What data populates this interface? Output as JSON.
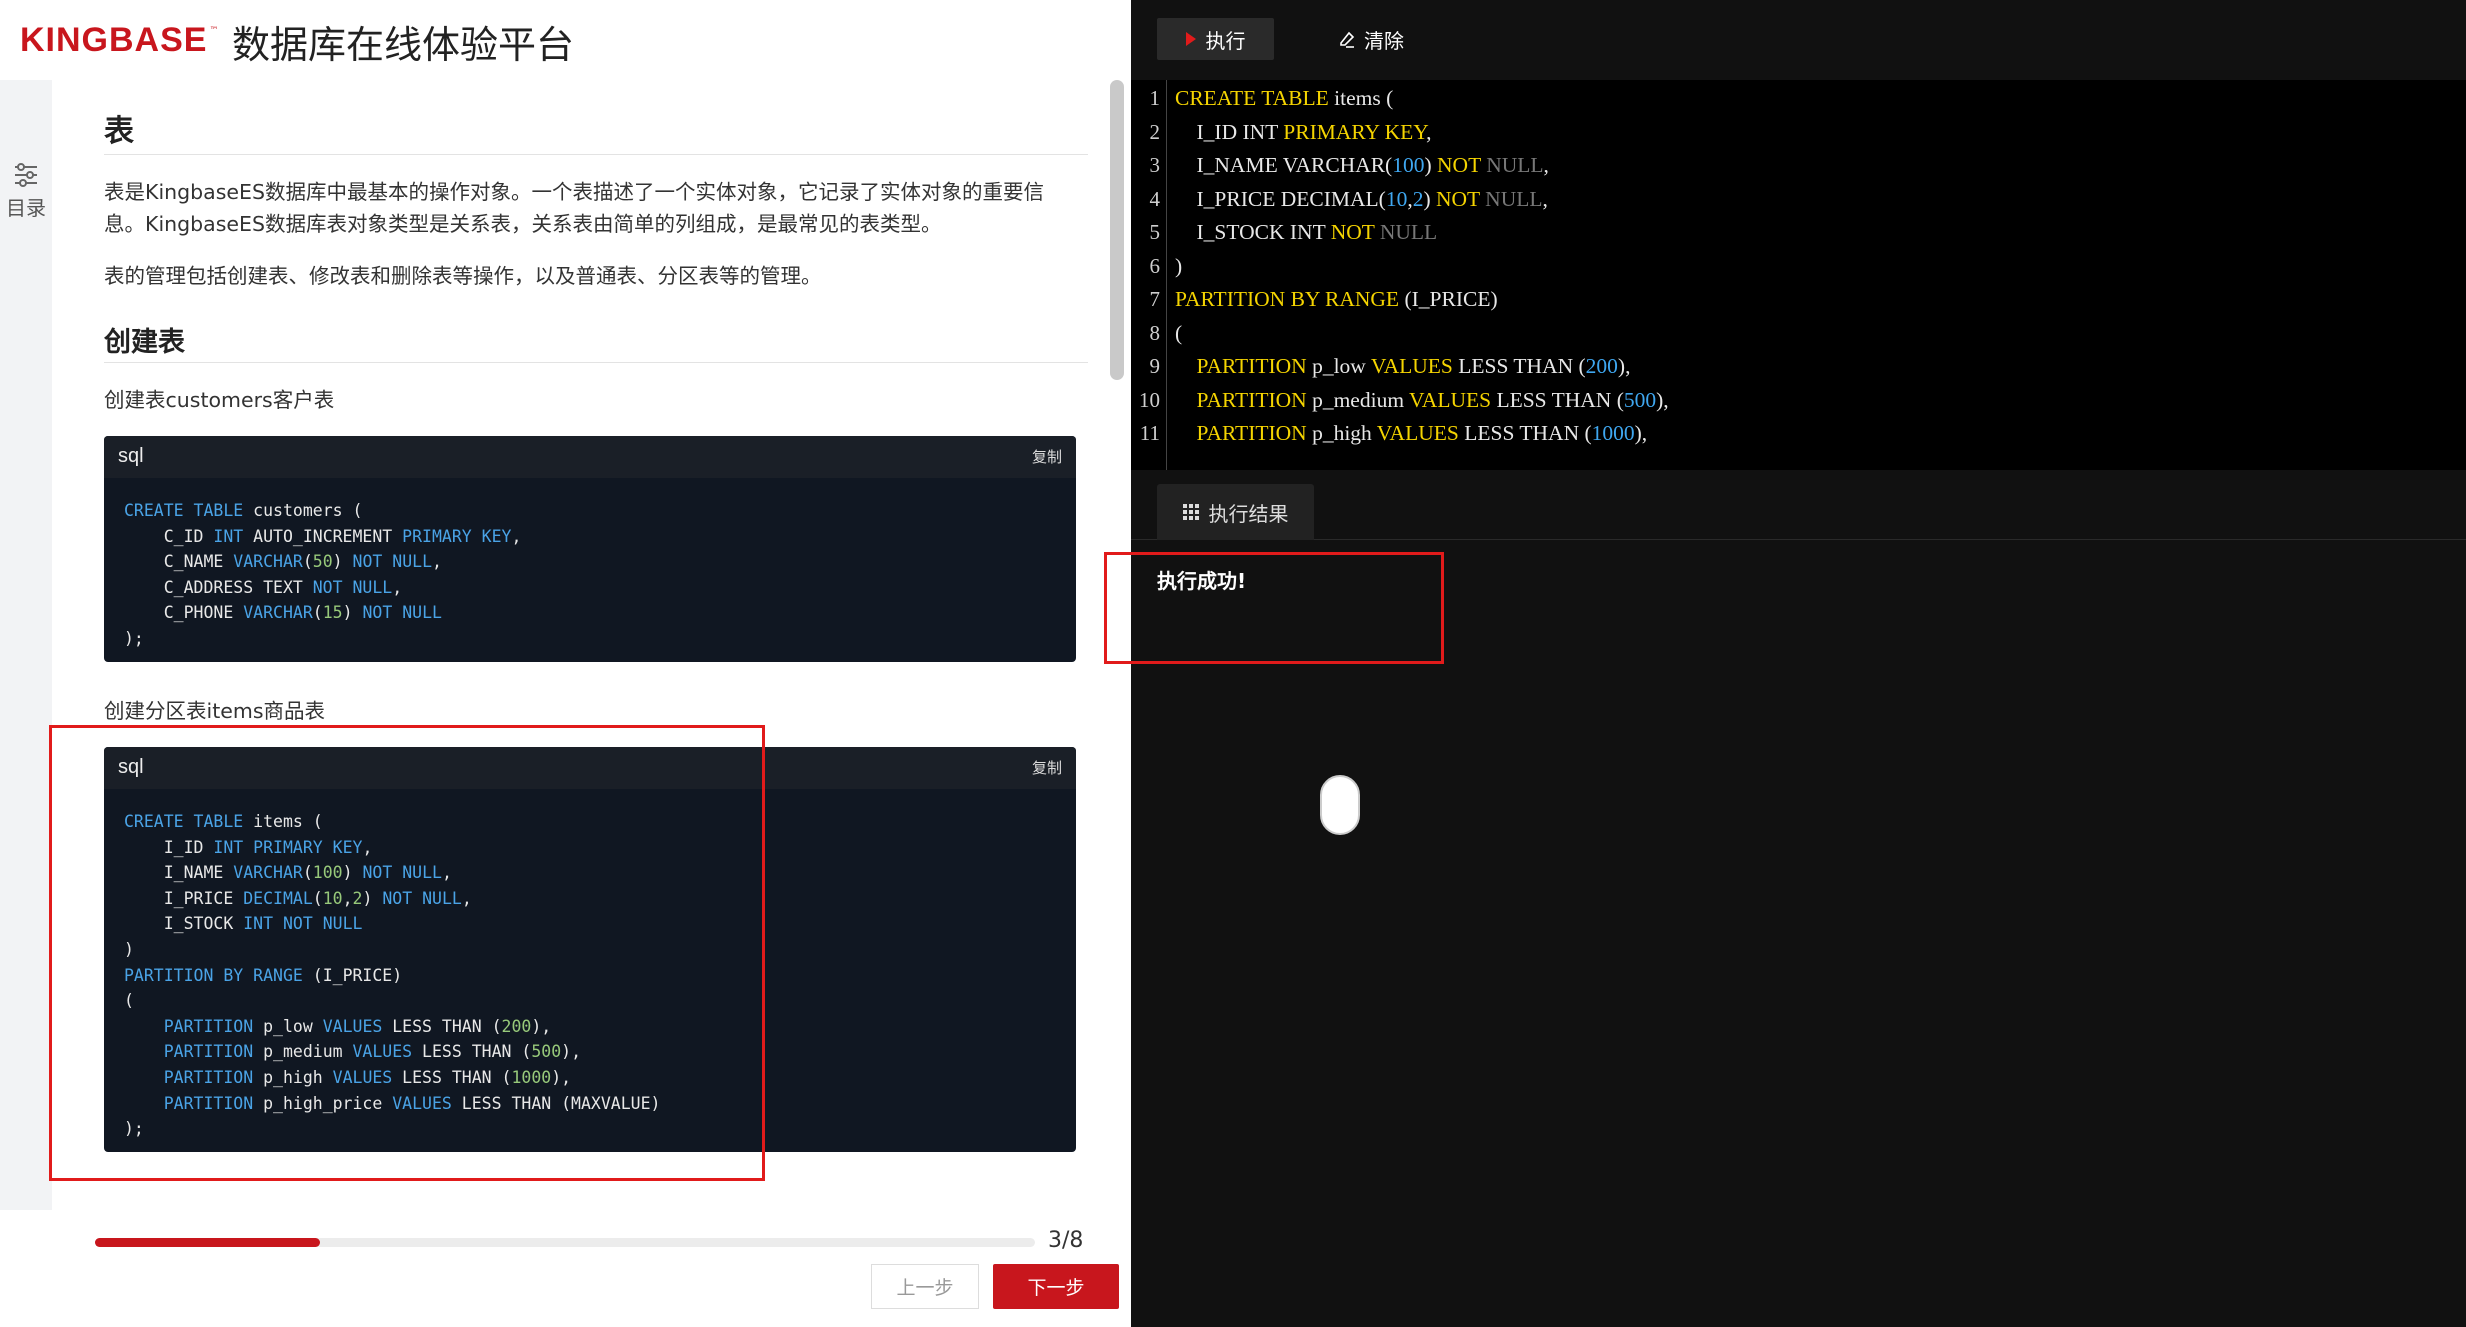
{
  "brand": {
    "logo": "KINGBASE",
    "logo_tm": "™",
    "title": "数据库在线体验平台"
  },
  "toc": {
    "label": "目录"
  },
  "doc": {
    "h1_table": "表",
    "p1": "表是KingbaseES数据库中最基本的操作对象。一个表描述了一个实体对象，它记录了实体对象的重要信息。KingbaseES数据库表对象类型是关系表，关系表由简单的列组成，是最常见的表类型。",
    "p2": "表的管理包括创建表、修改表和删除表等操作，以及普通表、分区表等的管理。",
    "h2_create": "创建表",
    "caption1": "创建表customers客户表",
    "caption2": "创建分区表items商品表",
    "code1_lang": "sql",
    "code2_lang": "sql",
    "copy_label": "复制",
    "code1": [
      [
        [
          "k",
          "CREATE"
        ],
        [
          "t",
          " "
        ],
        [
          "k",
          "TABLE"
        ],
        [
          "t",
          " customers ("
        ]
      ],
      [
        [
          "t",
          "    C_ID "
        ],
        [
          "k",
          "INT"
        ],
        [
          "t",
          " AUTO_INCREMENT "
        ],
        [
          "k",
          "PRIMARY"
        ],
        [
          "t",
          " "
        ],
        [
          "k",
          "KEY"
        ],
        [
          "t",
          ","
        ]
      ],
      [
        [
          "t",
          "    C_NAME "
        ],
        [
          "k",
          "VARCHAR"
        ],
        [
          "t",
          "("
        ],
        [
          "n",
          "50"
        ],
        [
          "t",
          ") "
        ],
        [
          "k",
          "NOT"
        ],
        [
          "t",
          " "
        ],
        [
          "k",
          "NULL"
        ],
        [
          "t",
          ","
        ]
      ],
      [
        [
          "t",
          "    C_ADDRESS TEXT "
        ],
        [
          "k",
          "NOT"
        ],
        [
          "t",
          " "
        ],
        [
          "k",
          "NULL"
        ],
        [
          "t",
          ","
        ]
      ],
      [
        [
          "t",
          "    C_PHONE "
        ],
        [
          "k",
          "VARCHAR"
        ],
        [
          "t",
          "("
        ],
        [
          "n",
          "15"
        ],
        [
          "t",
          ") "
        ],
        [
          "k",
          "NOT"
        ],
        [
          "t",
          " "
        ],
        [
          "k",
          "NULL"
        ]
      ],
      [
        [
          "t",
          ");"
        ]
      ]
    ],
    "code2": [
      [
        [
          "k",
          "CREATE"
        ],
        [
          "t",
          " "
        ],
        [
          "k",
          "TABLE"
        ],
        [
          "t",
          " items ("
        ]
      ],
      [
        [
          "t",
          "    I_ID "
        ],
        [
          "k",
          "INT"
        ],
        [
          "t",
          " "
        ],
        [
          "k",
          "PRIMARY"
        ],
        [
          "t",
          " "
        ],
        [
          "k",
          "KEY"
        ],
        [
          "t",
          ","
        ]
      ],
      [
        [
          "t",
          "    I_NAME "
        ],
        [
          "k",
          "VARCHAR"
        ],
        [
          "t",
          "("
        ],
        [
          "n",
          "100"
        ],
        [
          "t",
          ") "
        ],
        [
          "k",
          "NOT"
        ],
        [
          "t",
          " "
        ],
        [
          "k",
          "NULL"
        ],
        [
          "t",
          ","
        ]
      ],
      [
        [
          "t",
          "    I_PRICE "
        ],
        [
          "k",
          "DECIMAL"
        ],
        [
          "t",
          "("
        ],
        [
          "n",
          "10"
        ],
        [
          "t",
          ","
        ],
        [
          "n",
          "2"
        ],
        [
          "t",
          ") "
        ],
        [
          "k",
          "NOT"
        ],
        [
          "t",
          " "
        ],
        [
          "k",
          "NULL"
        ],
        [
          "t",
          ","
        ]
      ],
      [
        [
          "t",
          "    I_STOCK "
        ],
        [
          "k",
          "INT"
        ],
        [
          "t",
          " "
        ],
        [
          "k",
          "NOT"
        ],
        [
          "t",
          " "
        ],
        [
          "k",
          "NULL"
        ]
      ],
      [
        [
          "t",
          ")"
        ]
      ],
      [
        [
          "k",
          "PARTITION"
        ],
        [
          "t",
          " "
        ],
        [
          "k",
          "BY"
        ],
        [
          "t",
          " "
        ],
        [
          "k",
          "RANGE"
        ],
        [
          "t",
          " (I_PRICE)"
        ]
      ],
      [
        [
          "t",
          "("
        ]
      ],
      [
        [
          "t",
          "    "
        ],
        [
          "k",
          "PARTITION"
        ],
        [
          "t",
          " p_low "
        ],
        [
          "k",
          "VALUES"
        ],
        [
          "t",
          " LESS THAN ("
        ],
        [
          "n",
          "200"
        ],
        [
          "t",
          "),"
        ]
      ],
      [
        [
          "t",
          "    "
        ],
        [
          "k",
          "PARTITION"
        ],
        [
          "t",
          " p_medium "
        ],
        [
          "k",
          "VALUES"
        ],
        [
          "t",
          " LESS THAN ("
        ],
        [
          "n",
          "500"
        ],
        [
          "t",
          "),"
        ]
      ],
      [
        [
          "t",
          "    "
        ],
        [
          "k",
          "PARTITION"
        ],
        [
          "t",
          " p_high "
        ],
        [
          "k",
          "VALUES"
        ],
        [
          "t",
          " LESS THAN ("
        ],
        [
          "n",
          "1000"
        ],
        [
          "t",
          "),"
        ]
      ],
      [
        [
          "t",
          "    "
        ],
        [
          "k",
          "PARTITION"
        ],
        [
          "t",
          " p_high_price "
        ],
        [
          "k",
          "VALUES"
        ],
        [
          "t",
          " LESS THAN (MAXVALUE)"
        ]
      ],
      [
        [
          "t",
          ");"
        ]
      ]
    ]
  },
  "progress": {
    "fraction": 0.239,
    "label": "3/8"
  },
  "nav": {
    "prev": "上一步",
    "next": "下一步"
  },
  "toolbar": {
    "run": "执行",
    "clear": "清除"
  },
  "editor": {
    "lines": [
      [
        [
          "k",
          "CREATE TABLE"
        ],
        [
          "t",
          " items ("
        ]
      ],
      [
        [
          "t",
          "    I_ID INT "
        ],
        [
          "k",
          "PRIMARY KEY"
        ],
        [
          "t",
          ","
        ]
      ],
      [
        [
          "t",
          "    I_NAME VARCHAR("
        ],
        [
          "n",
          "100"
        ],
        [
          "t",
          ") "
        ],
        [
          "k",
          "NOT"
        ],
        [
          "t",
          " "
        ],
        [
          "g",
          "NULL"
        ],
        [
          "t",
          ","
        ]
      ],
      [
        [
          "t",
          "    I_PRICE DECIMAL("
        ],
        [
          "n",
          "10"
        ],
        [
          "t",
          ","
        ],
        [
          "n",
          "2"
        ],
        [
          "t",
          ") "
        ],
        [
          "k",
          "NOT"
        ],
        [
          "t",
          " "
        ],
        [
          "g",
          "NULL"
        ],
        [
          "t",
          ","
        ]
      ],
      [
        [
          "t",
          "    I_STOCK INT "
        ],
        [
          "k",
          "NOT"
        ],
        [
          "t",
          " "
        ],
        [
          "g",
          "NULL"
        ]
      ],
      [
        [
          "t",
          ")"
        ]
      ],
      [
        [
          "k",
          "PARTITION BY RANGE"
        ],
        [
          "t",
          " (I_PRICE)"
        ]
      ],
      [
        [
          "t",
          "("
        ]
      ],
      [
        [
          "t",
          "    "
        ],
        [
          "k",
          "PARTITION"
        ],
        [
          "t",
          " p_low "
        ],
        [
          "k",
          "VALUES"
        ],
        [
          "t",
          " LESS THAN ("
        ],
        [
          "n",
          "200"
        ],
        [
          "t",
          "),"
        ]
      ],
      [
        [
          "t",
          "    "
        ],
        [
          "k",
          "PARTITION"
        ],
        [
          "t",
          " p_medium "
        ],
        [
          "k",
          "VALUES"
        ],
        [
          "t",
          " LESS THAN ("
        ],
        [
          "n",
          "500"
        ],
        [
          "t",
          "),"
        ]
      ],
      [
        [
          "t",
          "    "
        ],
        [
          "k",
          "PARTITION"
        ],
        [
          "t",
          " p_high "
        ],
        [
          "k",
          "VALUES"
        ],
        [
          "t",
          " LESS THAN ("
        ],
        [
          "n",
          "1000"
        ],
        [
          "t",
          "),"
        ]
      ]
    ]
  },
  "results": {
    "tab": "执行结果",
    "message": "执行成功!"
  },
  "colors": {
    "brand_red": "#c8161d",
    "editor_keyword": "#f5d400",
    "editor_number": "#3fa7f0",
    "code_keyword": "#4aa3e6",
    "highlight_box": "#e11b1b"
  }
}
